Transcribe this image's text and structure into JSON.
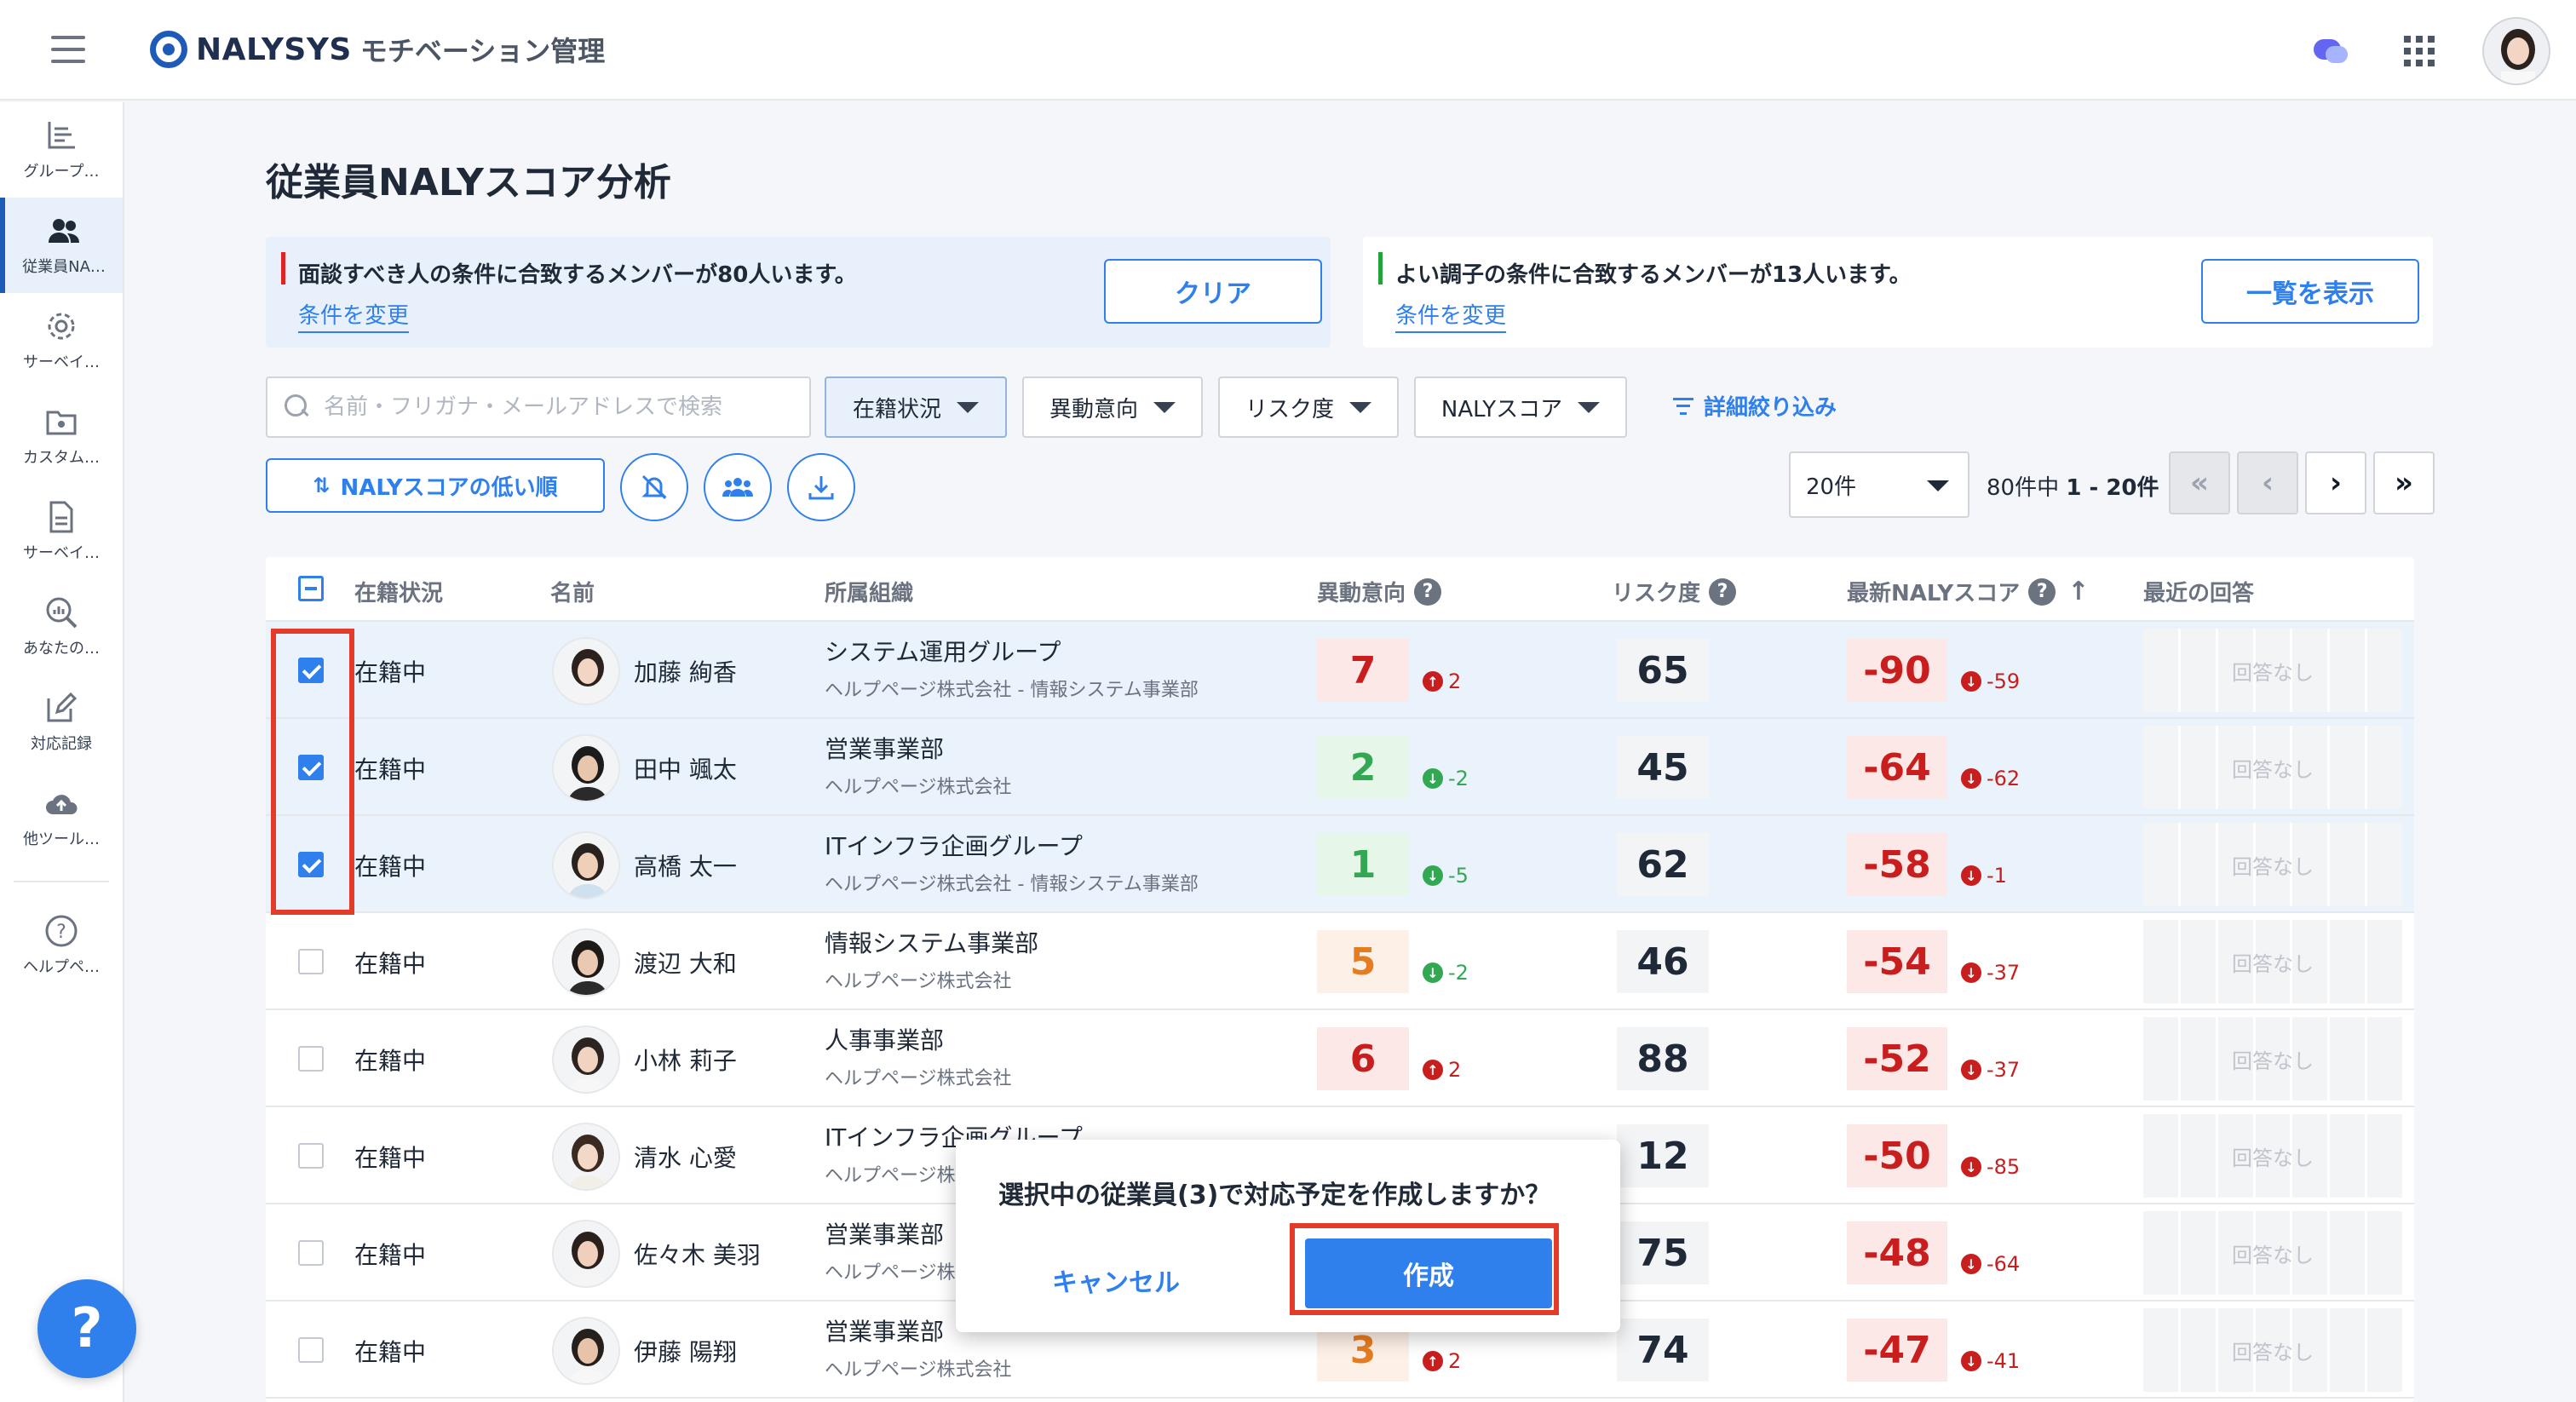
{
  "header": {
    "logo_text": "NALYSYS",
    "logo_sub": "モチベーション管理"
  },
  "sidebar": {
    "items": [
      {
        "label": "グループ…",
        "icon": "bar-chart-icon"
      },
      {
        "label": "従業員NA…",
        "icon": "people-icon"
      },
      {
        "label": "サーベイ…",
        "icon": "gear-icon"
      },
      {
        "label": "カスタム…",
        "icon": "folder-gear-icon"
      },
      {
        "label": "サーベイ…",
        "icon": "document-icon"
      },
      {
        "label": "あなたの…",
        "icon": "magnify-chart-icon"
      },
      {
        "label": "対応記録",
        "icon": "edit-icon"
      },
      {
        "label": "他ツール…",
        "icon": "cloud-upload-icon"
      },
      {
        "label": "ヘルプペ…",
        "icon": "help-circle-icon"
      }
    ],
    "fab": "?"
  },
  "page": {
    "title": "従業員NALYスコア分析"
  },
  "alerts": {
    "interview": {
      "message": "面談すべき人の条件に合致するメンバーが80人います。",
      "link": "条件を変更",
      "button": "クリア"
    },
    "good": {
      "message": "よい調子の条件に合致するメンバーが13人います。",
      "link": "条件を変更",
      "button": "一覧を表示"
    }
  },
  "filters": {
    "search_placeholder": "名前・フリガナ・メールアドレスで検索",
    "status": "在籍状況",
    "move": "異動意向",
    "risk": "リスク度",
    "naly": "NALYスコア",
    "detail": "詳細絞り込み",
    "sort": "NALYスコアの低い順"
  },
  "pagination": {
    "page_size": "20件",
    "info_prefix": "80件中",
    "info_range": "1 - 20件",
    "first": "«",
    "prev": "‹",
    "next": "›",
    "last": "»"
  },
  "table": {
    "headers": {
      "status": "在籍状況",
      "name": "名前",
      "org": "所属組織",
      "move": "異動意向",
      "risk": "リスク度",
      "naly": "最新NALYスコア",
      "recent": "最近の回答"
    },
    "rows": [
      {
        "checked": true,
        "status": "在籍中",
        "name": "加藤 絢香",
        "org": "システム運用グループ",
        "org_sub": "ヘルプページ株式会社 - 情報システム事業部",
        "move": "7",
        "move_delta": "2",
        "move_dir": "up",
        "risk": "65",
        "naly": "-90",
        "naly_delta": "-59",
        "recent": "回答なし"
      },
      {
        "checked": true,
        "status": "在籍中",
        "name": "田中 颯太",
        "org": "営業事業部",
        "org_sub": "ヘルプページ株式会社",
        "move": "2",
        "move_delta": "-2",
        "move_dir": "down",
        "risk": "45",
        "naly": "-64",
        "naly_delta": "-62",
        "recent": "回答なし"
      },
      {
        "checked": true,
        "status": "在籍中",
        "name": "高橋 太一",
        "org": "ITインフラ企画グループ",
        "org_sub": "ヘルプページ株式会社 - 情報システム事業部",
        "move": "1",
        "move_delta": "-5",
        "move_dir": "down",
        "risk": "62",
        "naly": "-58",
        "naly_delta": "-1",
        "recent": "回答なし"
      },
      {
        "checked": false,
        "status": "在籍中",
        "name": "渡辺 大和",
        "org": "情報システム事業部",
        "org_sub": "ヘルプページ株式会社",
        "move": "5",
        "move_delta": "-2",
        "move_dir": "down",
        "risk": "46",
        "naly": "-54",
        "naly_delta": "-37",
        "recent": "回答なし"
      },
      {
        "checked": false,
        "status": "在籍中",
        "name": "小林 莉子",
        "org": "人事事業部",
        "org_sub": "ヘルプページ株式会社",
        "move": "6",
        "move_delta": "2",
        "move_dir": "up",
        "risk": "88",
        "naly": "-52",
        "naly_delta": "-37",
        "recent": "回答なし"
      },
      {
        "checked": false,
        "status": "在籍中",
        "name": "清水 心愛",
        "org": "ITインフラ企画グループ",
        "org_sub": "ヘルプページ株式会社",
        "move": "",
        "move_delta": "",
        "move_dir": "",
        "risk": "12",
        "naly": "-50",
        "naly_delta": "-85",
        "recent": "回答なし"
      },
      {
        "checked": false,
        "status": "在籍中",
        "name": "佐々木 美羽",
        "org": "営業事業部",
        "org_sub": "ヘルプページ株式会社",
        "move": "",
        "move_delta": "",
        "move_dir": "",
        "risk": "75",
        "naly": "-48",
        "naly_delta": "-64",
        "recent": "回答なし"
      },
      {
        "checked": false,
        "status": "在籍中",
        "name": "伊藤 陽翔",
        "org": "営業事業部",
        "org_sub": "ヘルプページ株式会社",
        "move": "3",
        "move_delta": "2",
        "move_dir": "up",
        "risk": "74",
        "naly": "-47",
        "naly_delta": "-41",
        "recent": "回答なし"
      }
    ]
  },
  "dialog": {
    "message": "選択中の従業員(3)で対応予定を作成しますか？",
    "cancel": "キャンセル",
    "create": "作成"
  }
}
